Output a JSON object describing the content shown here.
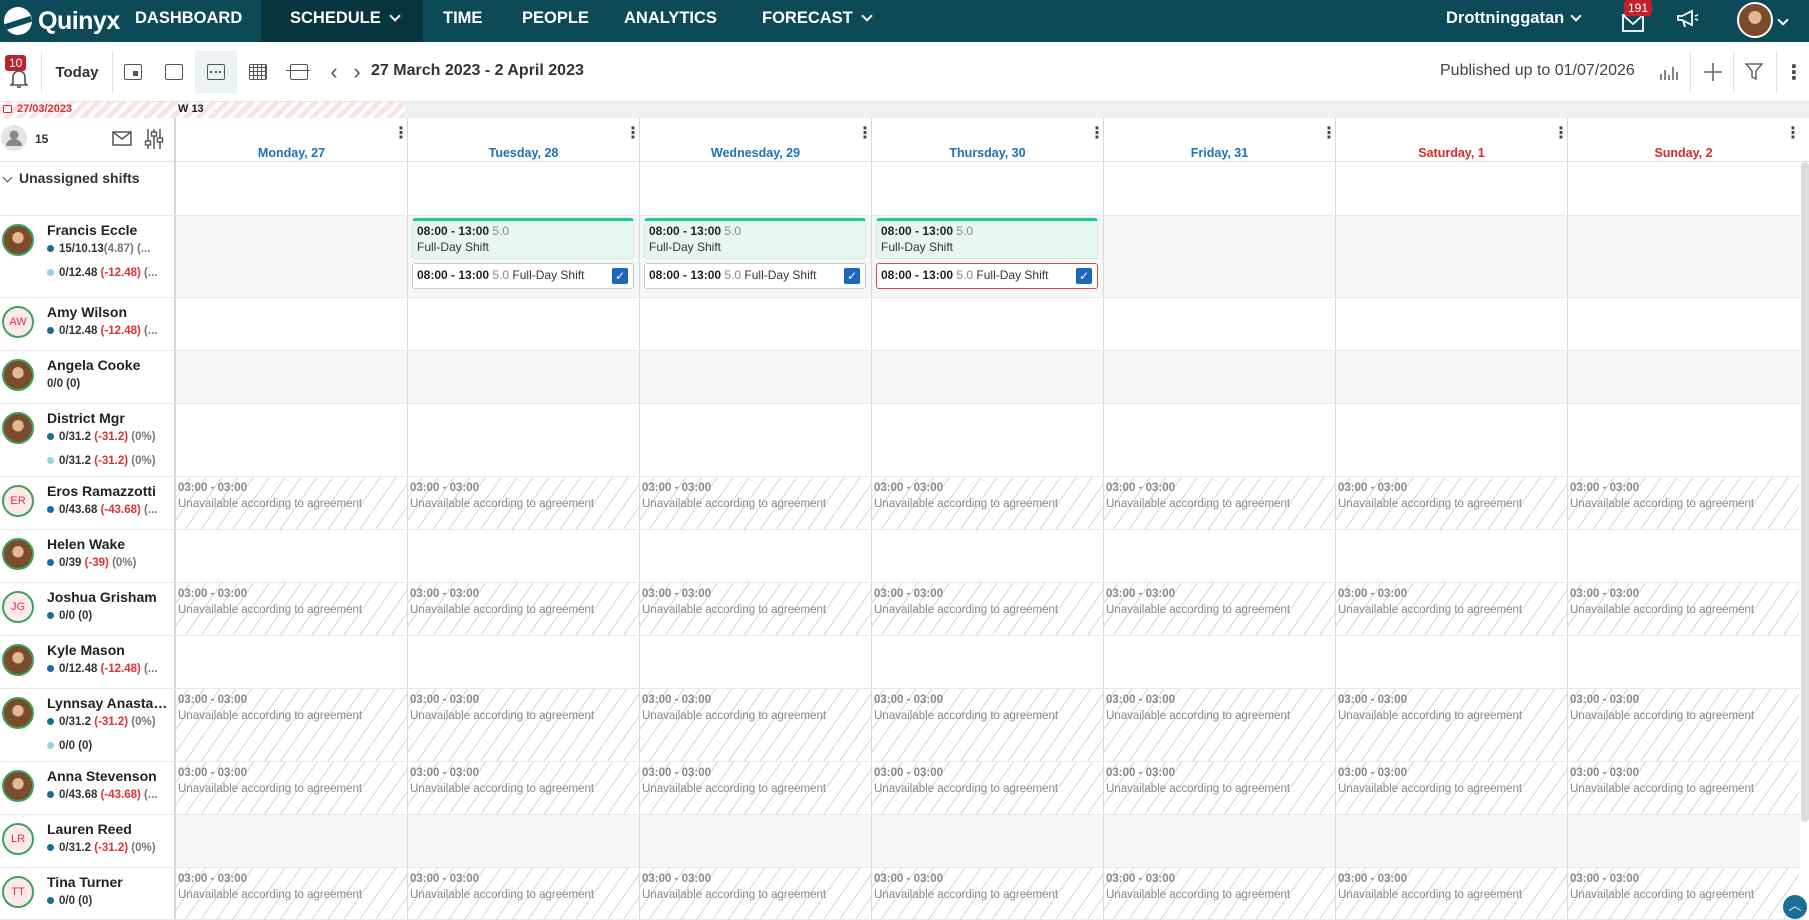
{
  "nav": {
    "logo": "Quinyx",
    "items": [
      "DASHBOARD",
      "SCHEDULE",
      "TIME",
      "PEOPLE",
      "ANALYTICS",
      "FORECAST"
    ],
    "unit": "Drottninggatan",
    "mail_count": "191"
  },
  "toolbar": {
    "notif_count": "10",
    "today_label": "Today",
    "date_range": "27 March 2023 - 2 April 2023",
    "published": "Published up to 01/07/2026"
  },
  "schedule": {
    "lock_date": "27/03/2023",
    "week": "W 13",
    "headcount": "15",
    "days": [
      "Monday, 27",
      "Tuesday, 28",
      "Wednesday, 29",
      "Thursday, 30",
      "Friday, 31",
      "Saturday, 1",
      "Sunday, 2"
    ],
    "unassigned_label": "Unassigned shifts",
    "unavailable": {
      "time": "03:00 - 03:00",
      "reason": "Unavailable according to agreement"
    },
    "shift": {
      "time": "08:00 - 13:00",
      "hours": "5.0",
      "name": "Full-Day Shift"
    },
    "employees": [
      {
        "name": "Francis Eccle",
        "avatar": "",
        "stats": [
          {
            "main": "15/10.13",
            "neg": "",
            "extra": "(4.87) (...",
            "light": false
          },
          {
            "main": "0/12.48",
            "neg": "(-12.48)",
            "extra": " (...",
            "light": true
          }
        ]
      },
      {
        "name": "Amy Wilson",
        "avatar": "AW",
        "stats": [
          {
            "main": "0/12.48",
            "neg": "(-12.48)",
            "extra": " (...",
            "light": false
          }
        ]
      },
      {
        "name": "Angela Cooke",
        "avatar": "",
        "stats": [
          {
            "main": "0/0 (0)",
            "neg": "",
            "extra": "",
            "light": false,
            "nodot": true
          }
        ]
      },
      {
        "name": "District Mgr",
        "avatar": "",
        "stats": [
          {
            "main": "0/31.2",
            "neg": "(-31.2)",
            "extra": " (0%)",
            "light": false
          },
          {
            "main": "0/31.2",
            "neg": "(-31.2)",
            "extra": " (0%)",
            "light": true
          }
        ]
      },
      {
        "name": "Eros Ramazzotti",
        "avatar": "ER",
        "stats": [
          {
            "main": "0/43.68",
            "neg": "(-43.68)",
            "extra": " (...",
            "light": false
          }
        ]
      },
      {
        "name": "Helen Wake",
        "avatar": "",
        "stats": [
          {
            "main": "0/39",
            "neg": "(-39)",
            "extra": " (0%)",
            "light": false
          }
        ]
      },
      {
        "name": "Joshua Grisham",
        "avatar": "JG",
        "stats": [
          {
            "main": "0/0 (0)",
            "neg": "",
            "extra": "",
            "light": false
          }
        ]
      },
      {
        "name": "Kyle Mason",
        "avatar": "",
        "stats": [
          {
            "main": "0/12.48",
            "neg": "(-12.48)",
            "extra": " (...",
            "light": false
          }
        ]
      },
      {
        "name": "Lynnsay Anastasia",
        "avatar": "",
        "stats": [
          {
            "main": "0/31.2",
            "neg": "(-31.2)",
            "extra": " (0%)",
            "light": false
          },
          {
            "main": "0/0 (0)",
            "neg": "",
            "extra": "",
            "light": true
          }
        ]
      },
      {
        "name": "Anna Stevenson",
        "avatar": "",
        "stats": [
          {
            "main": "0/43.68",
            "neg": "(-43.68)",
            "extra": " (...",
            "light": false
          }
        ]
      },
      {
        "name": "Lauren Reed",
        "avatar": "LR",
        "stats": [
          {
            "main": "0/31.2",
            "neg": "(-31.2)",
            "extra": " (0%)",
            "light": false
          }
        ]
      },
      {
        "name": "Tina Turner",
        "avatar": "TT",
        "stats": [
          {
            "main": "0/0 (0)",
            "neg": "",
            "extra": "",
            "light": false
          }
        ]
      }
    ]
  },
  "colors": {
    "nav_bg": "#0b4a56",
    "weekday": "#1a72b8",
    "weekend": "#d52b2b",
    "shift_accent": "#23c98d",
    "checkbox": "#1867b8",
    "error": "#d8474f"
  },
  "icons": [
    "bell-icon",
    "calendar-icon",
    "chevron-left-icon",
    "chevron-right-icon",
    "bar-chart-icon",
    "plus-icon",
    "filter-icon",
    "more-icon",
    "mail-icon",
    "megaphone-icon",
    "lock-icon",
    "user-icon",
    "sliders-icon"
  ]
}
